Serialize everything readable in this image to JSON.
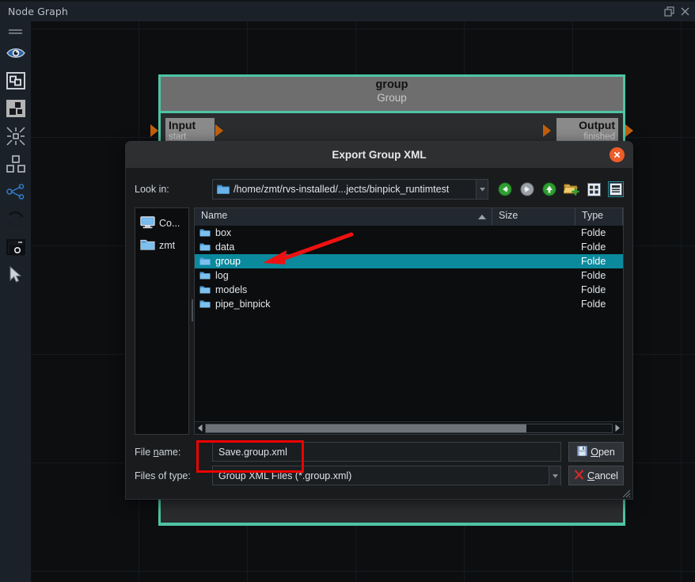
{
  "window": {
    "title": "Node Graph",
    "buttons": [
      {
        "name": "restore-icon",
        "label": "Restore"
      },
      {
        "name": "close-icon",
        "label": "Close"
      }
    ]
  },
  "toolbar": {
    "grip": "drag-handle",
    "items": [
      {
        "name": "eye-icon",
        "label": "Visibility",
        "selected": false
      },
      {
        "name": "frame-node-icon",
        "label": "Frame Node",
        "selected": false
      },
      {
        "name": "nodes-icon",
        "label": "Nodes",
        "selected": true
      },
      {
        "name": "collapse-icon",
        "label": "Collapse",
        "selected": false
      },
      {
        "name": "layout-icon",
        "label": "Layout",
        "selected": false
      },
      {
        "name": "share-nodes-icon",
        "label": "Connections",
        "selected": false
      },
      {
        "name": "refresh-icon",
        "label": "Refresh",
        "selected": false
      },
      {
        "name": "snapshot-icon",
        "label": "Snapshot",
        "selected": false
      },
      {
        "name": "cursor-icon",
        "label": "Select",
        "selected": false
      }
    ]
  },
  "node": {
    "name": "group",
    "type": "Group",
    "input_label": "Input",
    "input_sub": "start",
    "output_label": "Output",
    "output_sub": "finished",
    "border_color": "#4ec5a5"
  },
  "dialog": {
    "title": "Export Group XML",
    "close_label": "Close",
    "lookin": {
      "label": "Look in:",
      "path": "/home/zmt/rvs-installed/...jects/binpick_runtimtest",
      "nav": [
        {
          "name": "back-icon",
          "label": "Back",
          "enabled": true
        },
        {
          "name": "forward-icon",
          "label": "Forward",
          "enabled": false
        },
        {
          "name": "parent-directory-icon",
          "label": "Parent Directory",
          "enabled": true
        },
        {
          "name": "new-folder-icon",
          "label": "Create New Folder",
          "enabled": true
        },
        {
          "name": "list-view-icon",
          "label": "List View",
          "enabled": true
        },
        {
          "name": "detail-view-icon",
          "label": "Detail View",
          "enabled": true,
          "selected": true
        }
      ]
    },
    "sidebar": {
      "items": [
        {
          "name": "sidebar-item-computer",
          "label": "Co...",
          "icon": "computer-icon"
        },
        {
          "name": "sidebar-item-zmt",
          "label": "zmt",
          "icon": "folder-icon"
        }
      ]
    },
    "filelist": {
      "columns": [
        "Name",
        "Size",
        "Type"
      ],
      "sort_column": "Name",
      "sort_direction": "ascending",
      "rows": [
        {
          "name": "box",
          "size": "",
          "type": "Folde",
          "selected": false
        },
        {
          "name": "data",
          "size": "",
          "type": "Folde",
          "selected": false
        },
        {
          "name": "group",
          "size": "",
          "type": "Folde",
          "selected": true
        },
        {
          "name": "log",
          "size": "",
          "type": "Folde",
          "selected": false
        },
        {
          "name": "models",
          "size": "",
          "type": "Folde",
          "selected": false
        },
        {
          "name": "pipe_binpick",
          "size": "",
          "type": "Folde",
          "selected": false
        }
      ],
      "hscroll_position": "0%"
    },
    "filename": {
      "label_pre": "File ",
      "label_key": "n",
      "label_post": "ame:",
      "value": "Save.group.xml"
    },
    "filetype": {
      "label": "Files of type:",
      "value": "Group XML Files (*.group.xml)"
    },
    "open_button": {
      "pre": "",
      "key": "O",
      "post": "pen",
      "icon": "save-icon"
    },
    "cancel_button": {
      "pre": "",
      "key": "C",
      "post": "ancel",
      "icon": "cancel-x-icon"
    }
  },
  "annotations": {
    "arrow_color": "#ee1111",
    "highlight_color": "#ee0000",
    "selection_color": "#0b8a9e"
  }
}
